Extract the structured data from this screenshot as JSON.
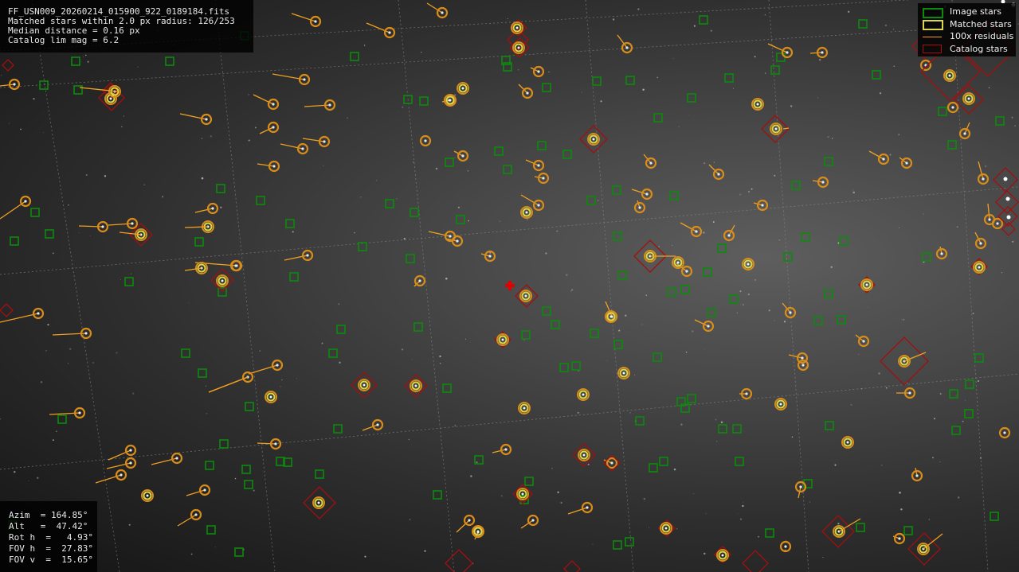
{
  "info": {
    "filename": "FF_USN009_20260214_015900_922_0189184.fits",
    "matched": "Matched stars within 2.0 px radius: 126/253",
    "median": "Median distance = 0.16 px",
    "limmag": "Catalog lim mag = 6.2"
  },
  "pointing": {
    "azim": "Azim  = 164.85°",
    "alt": "Alt   =  47.42°",
    "roth": "Rot h  =   4.93°",
    "fovh": "FOV h  =  27.83°",
    "fovv": "FOV v  =  15.65°"
  },
  "legend": {
    "image_stars": "Image stars",
    "matched_stars": "Matched stars",
    "residuals": "100x residuals",
    "catalog_stars": "Catalog stars"
  },
  "colors": {
    "image_star": "#0c8a0c",
    "matched_star": "#d9d94a",
    "catalog_star": "#a01010",
    "residual": "#f0a020",
    "orange_ring": "#d88c1a",
    "grid": "#8a8a8a",
    "center_cross": "#e00000"
  }
}
